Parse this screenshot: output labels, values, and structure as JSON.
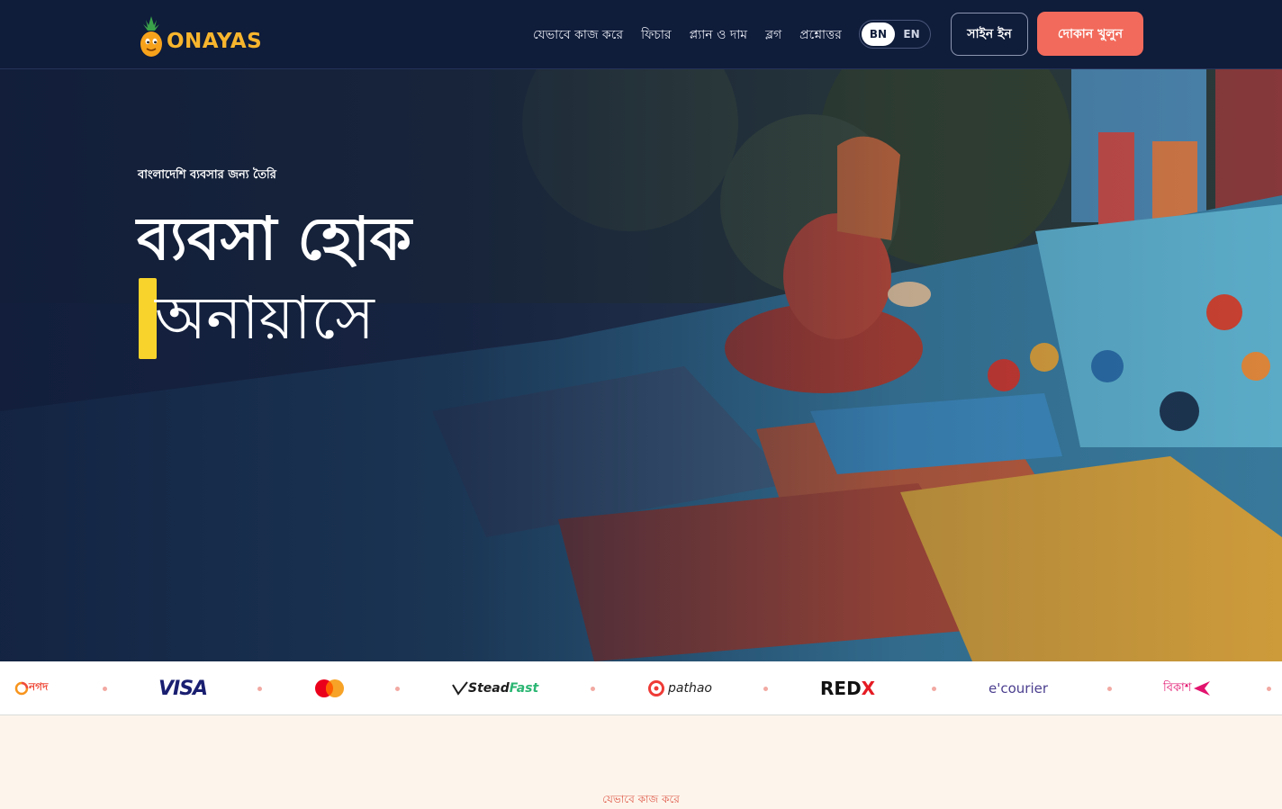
{
  "brand": {
    "name": "ONAYAS"
  },
  "nav": {
    "items": [
      "যেভাবে কাজ করে",
      "ফিচার",
      "প্ল্যান ও দাম",
      "ব্লগ",
      "প্রশ্নোত্তর"
    ]
  },
  "language": {
    "options": [
      "BN",
      "EN"
    ],
    "selected": "BN"
  },
  "header_actions": {
    "signin": "সাইন ইন",
    "open_shop": "দোকান খুলুন"
  },
  "hero": {
    "tagline": "বাংলাদেশি ব্যবসার জন্য তৈরি",
    "headline_line1": "ব্যবসা হোক",
    "headline_line2": "অনায়াসে"
  },
  "partners": {
    "nagad": "নগদ",
    "visa": "VISA",
    "mastercard": "mastercard-logo",
    "steadfast_main": "Stead",
    "steadfast_accent": "Fast",
    "pathao": "pathao",
    "redx_main": "RED",
    "redx_accent": "X",
    "ecourier": "e'courier",
    "bkash": "বিকাশ"
  },
  "next_section": {
    "label": "যেভাবে কাজ করে"
  },
  "colors": {
    "header_bg": "#0f1c3a",
    "accent": "#f26a5b",
    "highlight": "#f7d32b",
    "brand": "#f7b52d",
    "page_bg": "#fdf5ec"
  }
}
